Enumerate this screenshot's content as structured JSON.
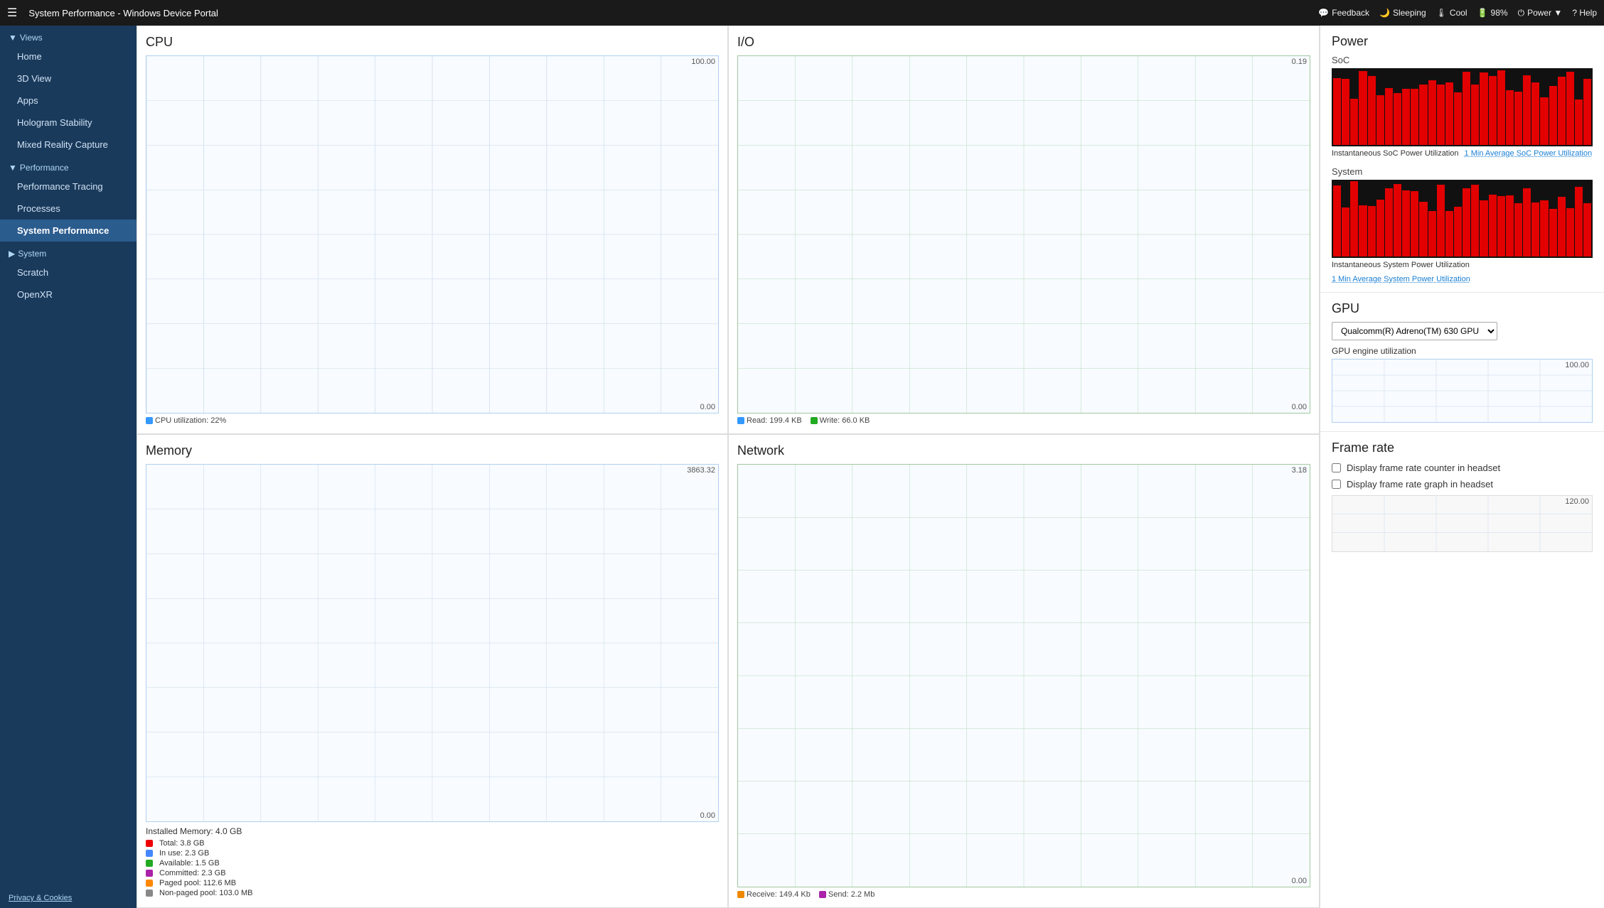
{
  "titlebar": {
    "hamburger": "☰",
    "title": "System Performance - Windows Device Portal",
    "feedback_label": "Feedback",
    "sleeping_label": "Sleeping",
    "cool_label": "Cool",
    "battery_label": "98%",
    "power_label": "Power ▼",
    "help_label": "? Help",
    "feedback_icon": "💬",
    "sleeping_icon": "🌙",
    "cool_icon": "🌡",
    "battery_icon": "🔋",
    "power_icon": "⏻"
  },
  "sidebar": {
    "collapse_icon": "◀",
    "views_label": "▼Views",
    "home_label": "Home",
    "view3d_label": "3D View",
    "apps_label": "Apps",
    "hologram_label": "Hologram Stability",
    "mixed_reality_label": "Mixed Reality Capture",
    "performance_label": "▼Performance",
    "perf_tracing_label": "Performance Tracing",
    "processes_label": "Processes",
    "system_performance_label": "System Performance",
    "system_label": "▶System",
    "scratch_label": "Scratch",
    "openxr_label": "OpenXR",
    "footer_label": "Privacy & Cookies"
  },
  "cpu": {
    "title": "CPU",
    "top_val": "100.00",
    "bottom_val": "0.00",
    "legend": "CPU utilization: 22%",
    "utilization": 22
  },
  "io": {
    "title": "I/O",
    "top_val": "0.19",
    "bottom_val": "0.00",
    "legend_read": "Read: 199.4 KB",
    "legend_write": "Write: 66.0 KB"
  },
  "memory": {
    "title": "Memory",
    "top_val": "3863.32",
    "bottom_val": "0.00",
    "installed": "Installed Memory: 4.0 GB",
    "legend_total": "Total: 3.8 GB",
    "legend_inuse": "In use: 2.3 GB",
    "legend_available": "Available: 1.5 GB",
    "legend_committed": "Committed: 2.3 GB",
    "legend_pagedpool": "Paged pool: 112.6 MB",
    "legend_nonpaged": "Non-paged pool: 103.0 MB",
    "colors": {
      "total": "#e00",
      "inuse": "#4488ff",
      "available": "#22aa22",
      "committed": "#aa22aa",
      "pagedpool": "#ff8800",
      "nonpaged": "#888"
    }
  },
  "network": {
    "title": "Network",
    "top_val": "3.18",
    "bottom_val": "0.00",
    "legend_receive": "Receive: 149.4 Kb",
    "legend_send": "Send: 2.2 Mb"
  },
  "power": {
    "title": "Power",
    "soc_label": "SoC",
    "system_label": "System",
    "instant_label": "Instantaneous SoC Power Utilization",
    "avg_label": "1 Min Average SoC Power Utilization",
    "sys_instant_label": "Instantaneous System Power Utilization",
    "sys_avg_label": "1 Min Average System Power Utilization",
    "bar_count": 30
  },
  "gpu": {
    "title": "GPU",
    "select_label": "Qualcomm(R) Adreno(TM) 630 GPU",
    "engine_label": "GPU engine utilization",
    "top_val": "100.00"
  },
  "frame_rate": {
    "title": "Frame rate",
    "checkbox1_label": "Display frame rate counter in headset",
    "checkbox2_label": "Display frame rate graph in headset",
    "fr_val": "120.00"
  }
}
